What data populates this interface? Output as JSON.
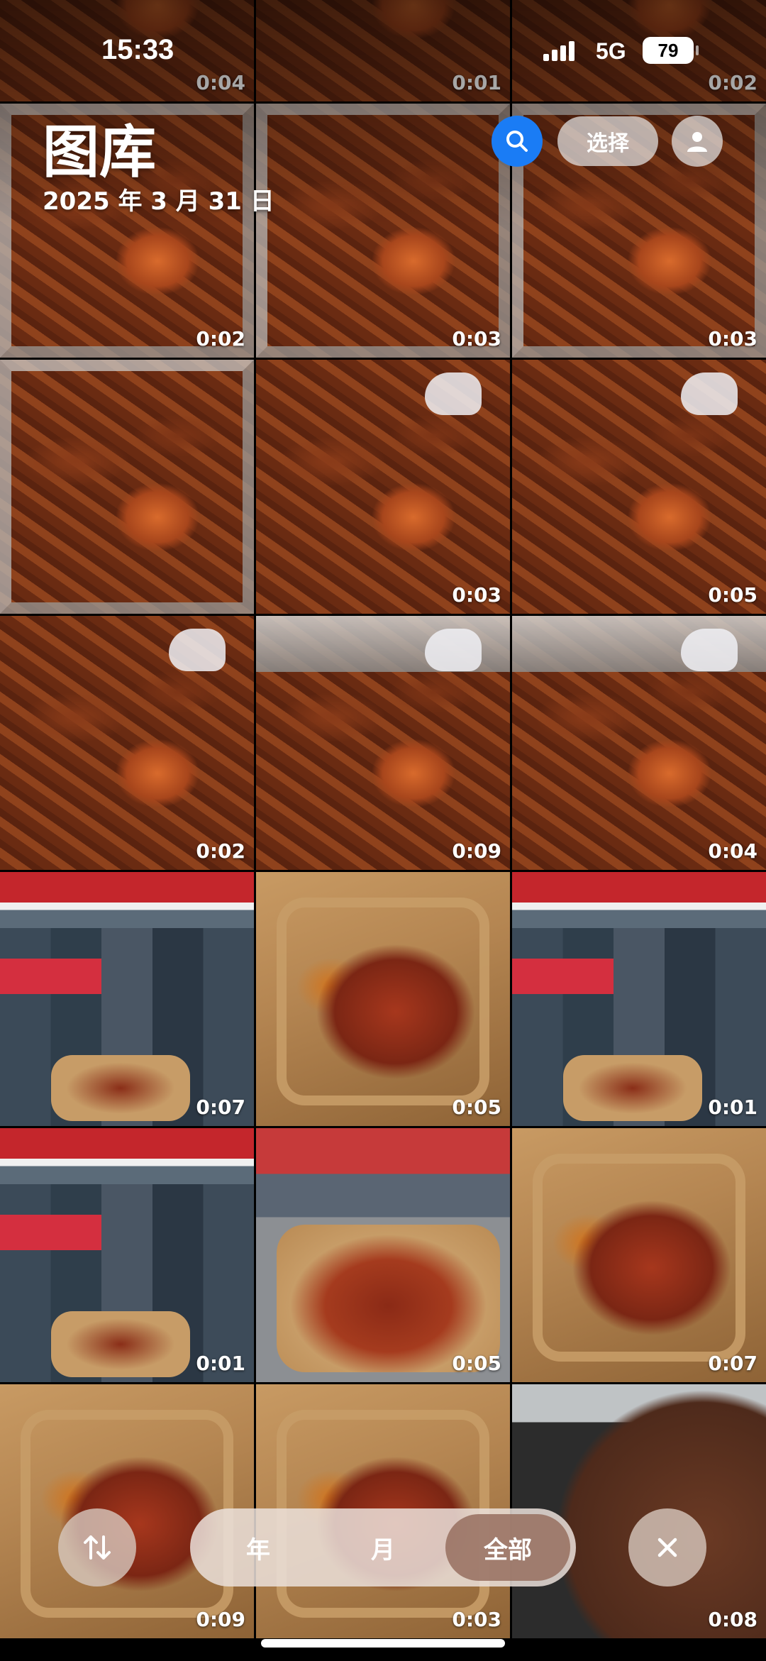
{
  "status_bar": {
    "time": "15:33",
    "network": "5G",
    "battery": "79"
  },
  "header": {
    "title": "图库",
    "date": "2025 年 3 月 31 日"
  },
  "toolbar": {
    "select_label": "选择"
  },
  "grid": {
    "tiles": [
      {
        "duration": "0:04",
        "kind": "braise tray2"
      },
      {
        "duration": "0:01",
        "kind": "braise tray2"
      },
      {
        "duration": "0:02",
        "kind": "braise tray2"
      },
      {
        "duration": "0:02",
        "kind": "braise tray"
      },
      {
        "duration": "0:03",
        "kind": "braise tray"
      },
      {
        "duration": "0:03",
        "kind": "braise tray"
      },
      {
        "duration": "",
        "kind": "braise tray"
      },
      {
        "duration": "0:03",
        "kind": "braise glove"
      },
      {
        "duration": "0:05",
        "kind": "braise glove"
      },
      {
        "duration": "0:02",
        "kind": "braise glove"
      },
      {
        "duration": "0:09",
        "kind": "braise tray2 glove"
      },
      {
        "duration": "0:04",
        "kind": "braise tray2 glove"
      },
      {
        "duration": "0:07",
        "kind": "shop"
      },
      {
        "duration": "0:05",
        "kind": "box"
      },
      {
        "duration": "0:01",
        "kind": "shop"
      },
      {
        "duration": "0:01",
        "kind": "shop"
      },
      {
        "duration": "0:05",
        "kind": "street"
      },
      {
        "duration": "0:07",
        "kind": "box"
      },
      {
        "duration": "0:09",
        "kind": "box"
      },
      {
        "duration": "0:03",
        "kind": "box"
      },
      {
        "duration": "0:08",
        "kind": "chop"
      }
    ]
  },
  "view_switcher": {
    "options": [
      "年",
      "月",
      "全部"
    ],
    "selected": "全部"
  },
  "icons": {
    "search": "search-icon",
    "profile": "person-icon",
    "sort": "sort-arrows-icon",
    "close": "close-icon"
  },
  "colors": {
    "accent": "#1a7cf5"
  }
}
